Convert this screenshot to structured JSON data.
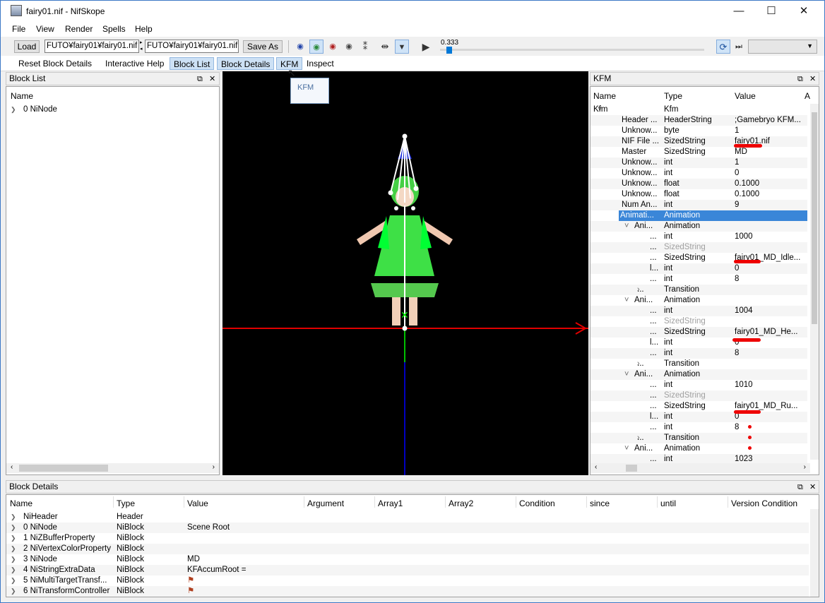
{
  "window": {
    "title": "fairy01.nif - NifSkope",
    "min": "—",
    "max": "☐",
    "close": "✕"
  },
  "menu": [
    "File",
    "View",
    "Render",
    "Spells",
    "Help"
  ],
  "toolbar": {
    "load": "Load",
    "path1": "FUTO¥fairy01¥fairy01.nif",
    "path2": "FUTO¥fairy01¥fairy01.nif",
    "save_as": "Save As",
    "time": "0.333"
  },
  "tabs": [
    "Reset Block Details",
    "Interactive Help",
    "Block List",
    "Block Details",
    "KFM",
    "Inspect"
  ],
  "tooltip": "KFM",
  "block_list": {
    "title": "Block List",
    "col_name": "Name",
    "items": [
      "0 NiNode"
    ]
  },
  "kfm": {
    "title": "KFM",
    "cols": [
      "Name",
      "Type",
      "Value",
      "A"
    ],
    "rows": [
      {
        "n": "Kfm",
        "t": "Kfm",
        "v": ""
      },
      {
        "n": "Header ...",
        "t": "HeaderString",
        "v": ";Gamebryo KFM..."
      },
      {
        "n": "Unknow...",
        "t": "byte",
        "v": "1"
      },
      {
        "n": "NIF File ...",
        "t": "SizedString",
        "v": "fairy01.nif"
      },
      {
        "n": "Master",
        "t": "SizedString",
        "v": "MD"
      },
      {
        "n": "Unknow...",
        "t": "int",
        "v": "1"
      },
      {
        "n": "Unknow...",
        "t": "int",
        "v": "0"
      },
      {
        "n": "Unknow...",
        "t": "float",
        "v": "0.1000"
      },
      {
        "n": "Unknow...",
        "t": "float",
        "v": "0.1000"
      },
      {
        "n": "Num An...",
        "t": "int",
        "v": "9"
      },
      {
        "n": "Animati...",
        "t": "Animation",
        "v": ""
      },
      {
        "n": "Ani...",
        "t": "Animation",
        "v": ""
      },
      {
        "n": "...",
        "t": "int",
        "v": "1000"
      },
      {
        "n": "...",
        "t": "SizedString",
        "v": ""
      },
      {
        "n": "...",
        "t": "SizedString",
        "v": "fairy01_MD_Idle..."
      },
      {
        "n": "l...",
        "t": "int",
        "v": "0"
      },
      {
        "n": "...",
        "t": "int",
        "v": "8"
      },
      {
        "n": "...",
        "t": "Transition",
        "v": ""
      },
      {
        "n": "Ani...",
        "t": "Animation",
        "v": ""
      },
      {
        "n": "...",
        "t": "int",
        "v": "1004"
      },
      {
        "n": "...",
        "t": "SizedString",
        "v": ""
      },
      {
        "n": "...",
        "t": "SizedString",
        "v": "fairy01_MD_He..."
      },
      {
        "n": "l...",
        "t": "int",
        "v": "0"
      },
      {
        "n": "...",
        "t": "int",
        "v": "8"
      },
      {
        "n": "...",
        "t": "Transition",
        "v": ""
      },
      {
        "n": "Ani...",
        "t": "Animation",
        "v": ""
      },
      {
        "n": "...",
        "t": "int",
        "v": "1010"
      },
      {
        "n": "...",
        "t": "SizedString",
        "v": ""
      },
      {
        "n": "...",
        "t": "SizedString",
        "v": "fairy01_MD_Ru..."
      },
      {
        "n": "l...",
        "t": "int",
        "v": "0"
      },
      {
        "n": "...",
        "t": "int",
        "v": "8"
      },
      {
        "n": "...",
        "t": "Transition",
        "v": ""
      },
      {
        "n": "Ani...",
        "t": "Animation",
        "v": ""
      },
      {
        "n": "...",
        "t": "int",
        "v": "1023"
      }
    ]
  },
  "block_details": {
    "title": "Block Details",
    "cols": [
      "Name",
      "Type",
      "Value",
      "Argument",
      "Array1",
      "Array2",
      "Condition",
      "since",
      "until",
      "Version Condition"
    ],
    "rows": [
      {
        "n": "NiHeader",
        "t": "Header",
        "v": ""
      },
      {
        "n": "0 NiNode",
        "t": "NiBlock",
        "v": "Scene Root"
      },
      {
        "n": "1 NiZBufferProperty",
        "t": "NiBlock",
        "v": ""
      },
      {
        "n": "2 NiVertexColorProperty",
        "t": "NiBlock",
        "v": ""
      },
      {
        "n": "3 NiNode",
        "t": "NiBlock",
        "v": "MD"
      },
      {
        "n": "4 NiStringExtraData",
        "t": "NiBlock",
        "v": "KFAccumRoot ="
      },
      {
        "n": "5 NiMultiTargetTransf...",
        "t": "NiBlock",
        "v": ""
      },
      {
        "n": "6 NiTransformController",
        "t": "NiBlock",
        "v": ""
      }
    ]
  }
}
